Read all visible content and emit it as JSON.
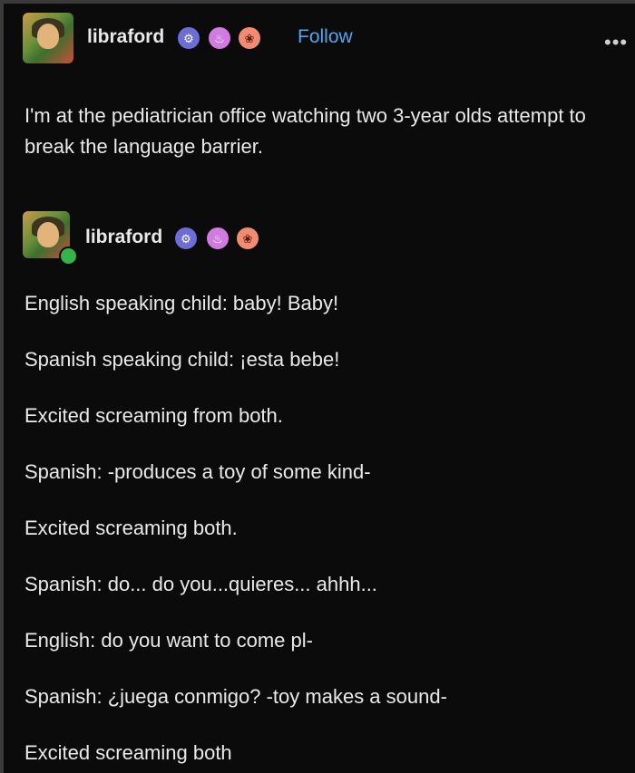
{
  "post": {
    "author": "libraford",
    "follow_label": "Follow",
    "more_icon": "•••",
    "text": "I'm at the pediatrician office watching two 3-year olds attempt to break the language barrier."
  },
  "reply": {
    "author": "libraford",
    "lines": [
      "English speaking child: baby! Baby!",
      "Spanish speaking child: ¡esta bebe!",
      "Excited screaming from both.",
      "Spanish: -produces a toy of some kind-",
      "Excited screaming both.",
      "Spanish: do... do you...quieres... ahhh...",
      "English: do you want to come pl-",
      "Spanish: ¿juega conmigo? -toy makes a sound-",
      "Excited screaming both"
    ]
  },
  "badges": [
    {
      "icon": "robot-badge-icon",
      "color": "#6d6dd6"
    },
    {
      "icon": "cupcake-badge-icon",
      "color": "#d07be0"
    },
    {
      "icon": "paw-badge-icon",
      "color": "#f18c72"
    }
  ],
  "colors": {
    "background": "#0b0b0b",
    "text": "#e9e9e9",
    "follow": "#4fa6ee"
  }
}
